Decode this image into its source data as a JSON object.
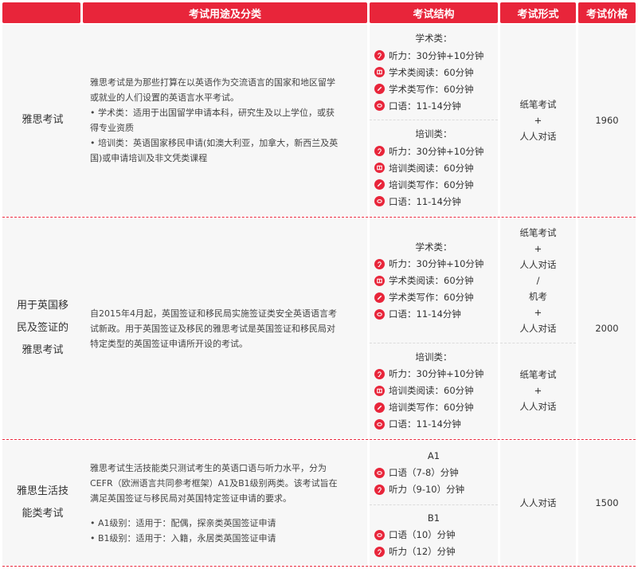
{
  "headers": [
    "考试用途及分类",
    "考试结构",
    "考试形式",
    "考试价格"
  ],
  "rows": [
    {
      "category": [
        "雅思考试"
      ],
      "description": [
        "雅思考试是为那些打算在以英语作为交流语言的国家和地区留学",
        "或就业的人们设置的英语言水平考试。",
        "• 学术类：适用于出国留学申请本科，研究生及以上学位，或获",
        "得专业资质",
        "• 培训类：英语国家移民申请(如澳大利亚，加拿大，新西兰及英",
        "国)或申请培训及非文凭类课程"
      ],
      "structures": [
        {
          "title": "学术类：",
          "items": [
            {
              "icon": "ear-icon",
              "text": "听力：30分钟+10分钟"
            },
            {
              "icon": "book-icon",
              "text": "学术类阅读：60分钟"
            },
            {
              "icon": "pencil-icon",
              "text": "学术类写作：60分钟"
            },
            {
              "icon": "mouth-icon",
              "text": "口语：11-14分钟"
            }
          ]
        },
        {
          "title": "培训类：",
          "items": [
            {
              "icon": "ear-icon",
              "text": "听力：30分钟+10分钟"
            },
            {
              "icon": "book-icon",
              "text": "培训类阅读：60分钟"
            },
            {
              "icon": "pencil-icon",
              "text": "培训类写作：60分钟"
            },
            {
              "icon": "mouth-icon",
              "text": "口语：11-14分钟"
            }
          ]
        }
      ],
      "forms": [
        [
          "纸笔考试",
          "+",
          "人人对话"
        ]
      ],
      "price": "1960"
    },
    {
      "category": [
        "用于英国移",
        "民及签证的",
        "雅思考试"
      ],
      "description": [
        "自2015年4月起，英国签证和移民局实施签证类安全英语语言考",
        "试新政。用于英国签证及移民的雅思考试是英国签证和移民局对",
        "特定类型的英国签证申请所开设的考试。"
      ],
      "structures": [
        {
          "title": "学术类：",
          "items": [
            {
              "icon": "ear-icon",
              "text": "听力：30分钟+10分钟"
            },
            {
              "icon": "book-icon",
              "text": "学术类阅读：60分钟"
            },
            {
              "icon": "pencil-icon",
              "text": "学术类写作：60分钟"
            },
            {
              "icon": "mouth-icon",
              "text": "口语：11-14分钟"
            }
          ]
        },
        {
          "title": "培训类：",
          "items": [
            {
              "icon": "ear-icon",
              "text": "听力：30分钟+10分钟"
            },
            {
              "icon": "book-icon",
              "text": "培训类阅读：60分钟"
            },
            {
              "icon": "pencil-icon",
              "text": "培训类写作：60分钟"
            },
            {
              "icon": "mouth-icon",
              "text": "口语：11-14分钟"
            }
          ]
        }
      ],
      "forms": [
        [
          "纸笔考试",
          "+",
          "人人对话",
          "/",
          "机考",
          "+",
          "人人对话"
        ],
        [
          "纸笔考试",
          "+",
          "人人对话"
        ]
      ],
      "price": "2000"
    },
    {
      "category": [
        "雅思生活技",
        "能类考试"
      ],
      "description": [
        "雅思考试生活技能类只测试考生的英语口语与听力水平，分为",
        "CEFR（欧洲语言共同参考框架）A1及B1级别两类。该考试旨在",
        "满足英国签证与移民局对英国特定签证申请的要求。",
        "",
        "• A1级别：适用于：配偶，探亲类英国签证申请",
        "• B1级别：适用于：入籍，永居类英国签证申请"
      ],
      "structures": [
        {
          "title": "A1",
          "items": [
            {
              "icon": "mouth-icon",
              "text": "口语（7-8）分钟"
            },
            {
              "icon": "ear-icon",
              "text": "听力（9-10）分钟"
            }
          ]
        },
        {
          "title": "B1",
          "items": [
            {
              "icon": "mouth-icon",
              "text": "口语（10）分钟"
            },
            {
              "icon": "ear-icon",
              "text": "听力（12）分钟"
            }
          ]
        }
      ],
      "forms": [
        [
          "人人对话"
        ]
      ],
      "price": "1500"
    }
  ],
  "colors": {
    "accent": "#e8253a",
    "cell_bg": "#f7f7f7"
  }
}
